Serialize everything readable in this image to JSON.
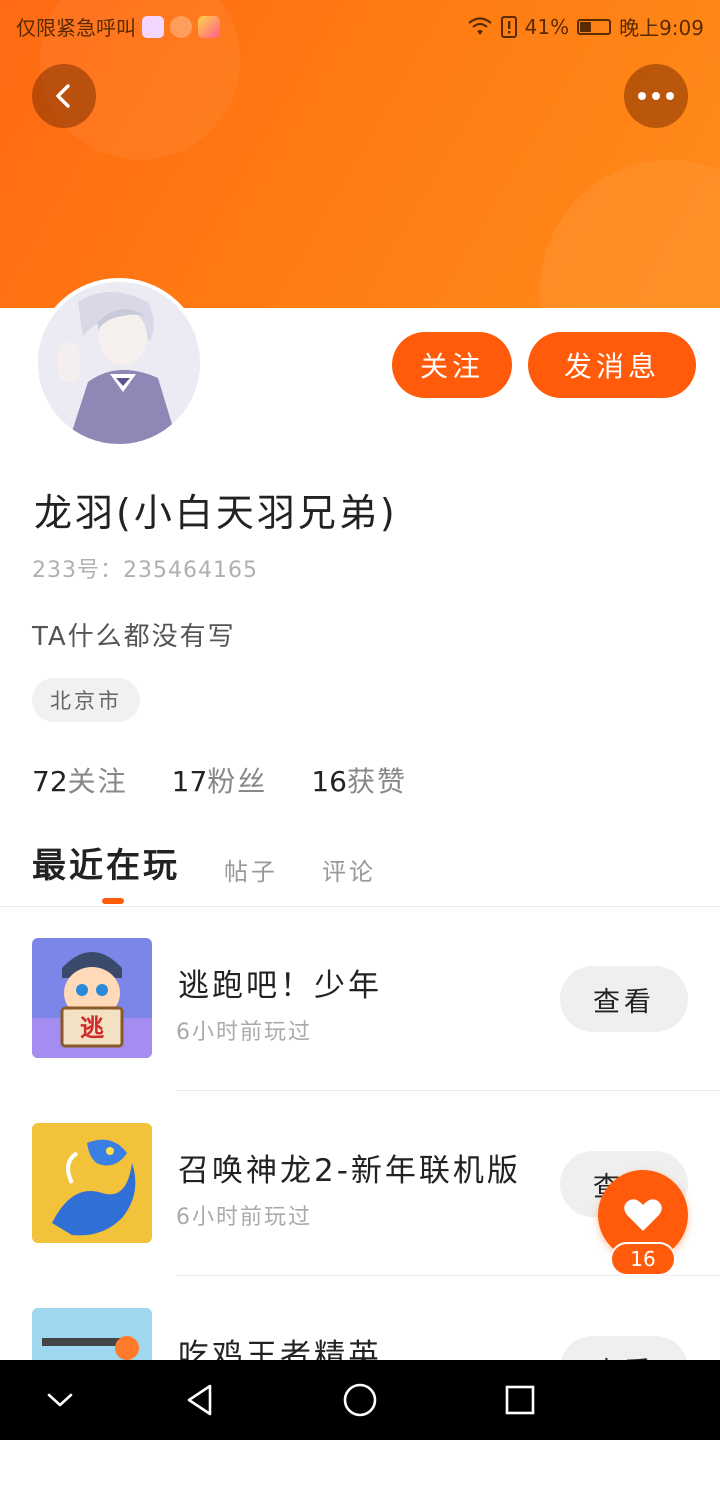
{
  "status_bar": {
    "left_text": "仅限紧急呼叫",
    "battery_percent": "41%",
    "battery_level": 0.41,
    "time": "晚上9:09"
  },
  "header": {
    "back_icon": "chevron-left-icon",
    "more_icon": "more-horizontal-icon"
  },
  "profile": {
    "follow_label": "关注",
    "message_label": "发消息",
    "name": "龙羽(小白天羽兄弟)",
    "uid": "233号：235464165",
    "bio": "TA什么都没有写",
    "location": "北京市"
  },
  "stats": {
    "following_count": "72",
    "following_label": "关注",
    "fans_count": "17",
    "fans_label": "粉丝",
    "likes_count": "16",
    "likes_label": "获赞"
  },
  "tabs": [
    {
      "label": "最近在玩",
      "active": true
    },
    {
      "label": "帖子",
      "active": false
    },
    {
      "label": "评论",
      "active": false
    }
  ],
  "games": [
    {
      "name": "逃跑吧！少年",
      "time": "6小时前玩过",
      "button": "查看",
      "thumb_text": "逃"
    },
    {
      "name": "召唤神龙2-新年联机版",
      "time": "6小时前玩过",
      "button": "查看"
    },
    {
      "name": "吃鸡王者精英",
      "time": "",
      "button": "查看"
    }
  ],
  "like_fab": {
    "icon": "heart-icon",
    "count": "16"
  },
  "colors": {
    "accent": "#ff5b0a",
    "header_start": "#ff6a13",
    "header_end": "#ff8c1a"
  }
}
